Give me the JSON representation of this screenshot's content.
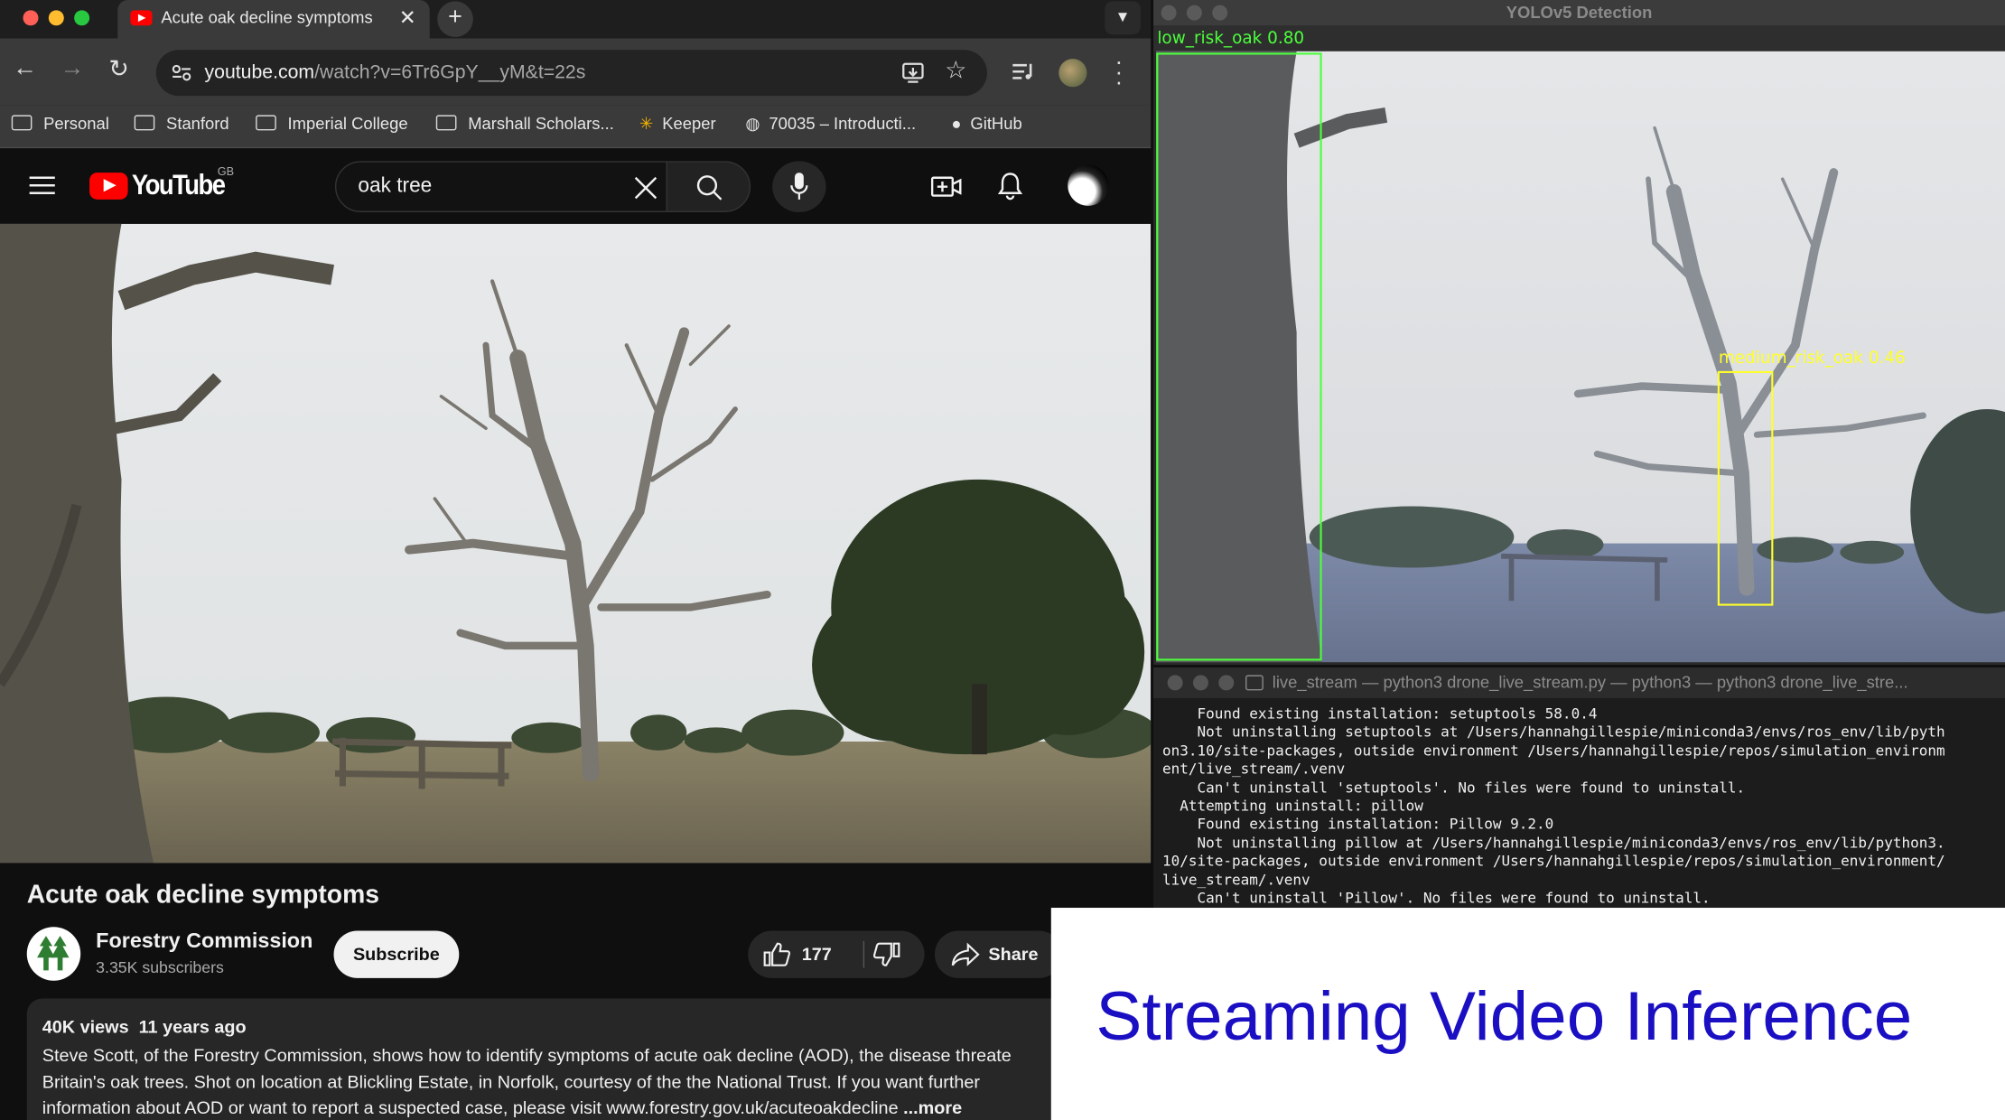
{
  "browser": {
    "tab_title": "Acute oak decline symptoms",
    "url_host": "youtube.com",
    "url_path": "/watch?v=6Tr6GpY__yM&t=22s",
    "bookmarks": [
      {
        "label": "Personal",
        "icon": "folder-icon"
      },
      {
        "label": "Stanford",
        "icon": "folder-icon"
      },
      {
        "label": "Imperial College",
        "icon": "folder-icon"
      },
      {
        "label": "Marshall Scholars...",
        "icon": "folder-icon"
      },
      {
        "label": "Keeper",
        "icon": "keeper-icon"
      },
      {
        "label": "70035 – Introducti...",
        "icon": "globe-icon"
      },
      {
        "label": "GitHub",
        "icon": "github-icon"
      }
    ]
  },
  "youtube": {
    "logo_text": "YouTube",
    "region": "GB",
    "search_value": "oak tree",
    "video_title": "Acute oak decline symptoms",
    "channel_name": "Forestry Commission",
    "channel_subs": "3.35K subscribers",
    "subscribe_label": "Subscribe",
    "like_count": "177",
    "share_label": "Share",
    "views": "40K views",
    "age": "11 years ago",
    "description": "Steve Scott, of the Forestry Commission, shows how to identify symptoms of acute oak decline (AOD), the disease threate Britain's oak trees. Shot on location at Blickling Estate, in Norfolk, courtesy of the the National Trust. If you want further information about AOD or want to report a suspected case, please visit www.forestry.gov.uk/acuteoakdecline",
    "more_label": "...more",
    "brand_color": "#ff0000"
  },
  "yolo": {
    "window_title": "YOLOv5 Detection",
    "detections": [
      {
        "label": "low_risk_oak",
        "score": "0.80",
        "color": "#4cff3c"
      },
      {
        "label": "medium_risk_oak",
        "score": "0.46",
        "color": "#ffff2a"
      }
    ]
  },
  "terminal": {
    "title": "live_stream — python3 drone_live_stream.py — python3 — python3 drone_live_stre...",
    "lines": [
      "    Found existing installation: setuptools 58.0.4",
      "    Not uninstalling setuptools at /Users/hannahgillespie/miniconda3/envs/ros_env/lib/pyth",
      "on3.10/site-packages, outside environment /Users/hannahgillespie/repos/simulation_environm",
      "ent/live_stream/.venv",
      "    Can't uninstall 'setuptools'. No files were found to uninstall.",
      "  Attempting uninstall: pillow",
      "    Found existing installation: Pillow 9.2.0",
      "    Not uninstalling pillow at /Users/hannahgillespie/miniconda3/envs/ros_env/lib/python3.",
      "10/site-packages, outside environment /Users/hannahgillespie/repos/simulation_environment/",
      "live_stream/.venv",
      "    Can't uninstall 'Pillow'. No files were found to uninstall."
    ]
  },
  "caption": "Streaming Video Inference"
}
